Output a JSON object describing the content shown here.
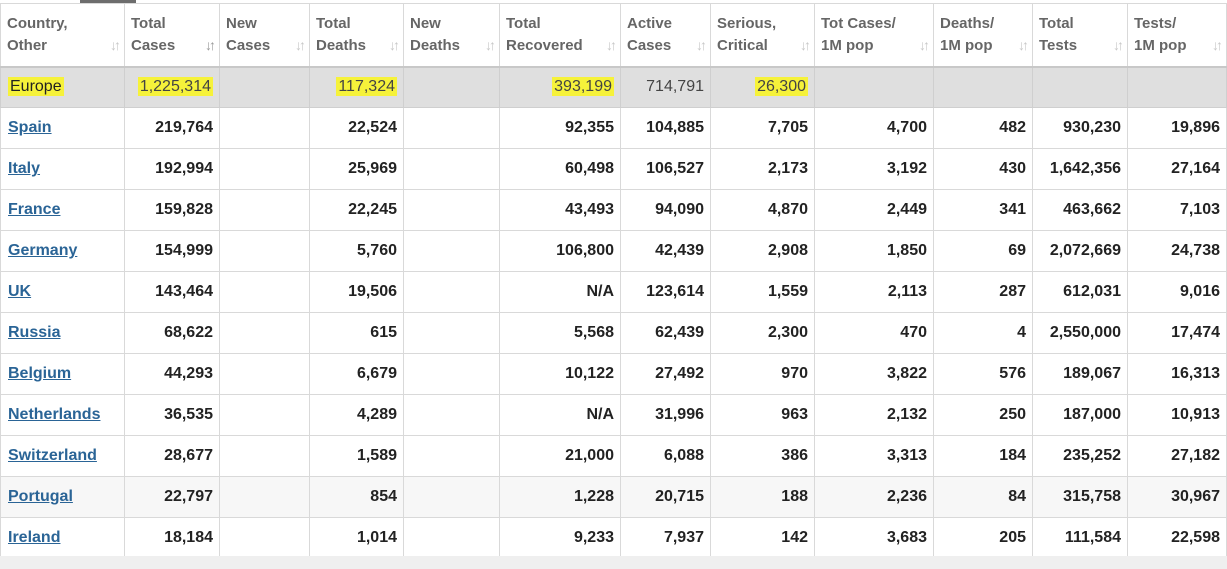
{
  "columns": [
    {
      "label1": "Country,",
      "label2": "Other"
    },
    {
      "label1": "Total",
      "label2": "Cases"
    },
    {
      "label1": "New",
      "label2": "Cases"
    },
    {
      "label1": "Total",
      "label2": "Deaths"
    },
    {
      "label1": "New",
      "label2": "Deaths"
    },
    {
      "label1": "Total",
      "label2": "Recovered"
    },
    {
      "label1": "Active",
      "label2": "Cases"
    },
    {
      "label1": "Serious,",
      "label2": "Critical"
    },
    {
      "label1": "Tot Cases/",
      "label2": "1M pop"
    },
    {
      "label1": "Deaths/",
      "label2": "1M pop"
    },
    {
      "label1": "Total",
      "label2": "Tests"
    },
    {
      "label1": "Tests/",
      "label2": "1M pop"
    }
  ],
  "icons": {
    "sort": "sort-arrows-icon",
    "sort_glyph": "↓↑",
    "sort_active": "sort-descending-icon",
    "highlight_color": "#f6f23a",
    "link_color": "#2a6496"
  },
  "region": {
    "country": "Europe",
    "total_cases": "1,225,314",
    "new_cases": "",
    "total_deaths": "117,324",
    "new_deaths": "",
    "total_recovered": "393,199",
    "active_cases": "714,791",
    "serious_critical": "26,300",
    "tot_cases_1m": "",
    "deaths_1m": "",
    "total_tests": "",
    "tests_1m": ""
  },
  "rows": [
    {
      "country": "Spain",
      "total_cases": "219,764",
      "new_cases": "",
      "total_deaths": "22,524",
      "new_deaths": "",
      "total_recovered": "92,355",
      "active_cases": "104,885",
      "serious_critical": "7,705",
      "tot_cases_1m": "4,700",
      "deaths_1m": "482",
      "total_tests": "930,230",
      "tests_1m": "19,896"
    },
    {
      "country": "Italy",
      "total_cases": "192,994",
      "new_cases": "",
      "total_deaths": "25,969",
      "new_deaths": "",
      "total_recovered": "60,498",
      "active_cases": "106,527",
      "serious_critical": "2,173",
      "tot_cases_1m": "3,192",
      "deaths_1m": "430",
      "total_tests": "1,642,356",
      "tests_1m": "27,164"
    },
    {
      "country": "France",
      "total_cases": "159,828",
      "new_cases": "",
      "total_deaths": "22,245",
      "new_deaths": "",
      "total_recovered": "43,493",
      "active_cases": "94,090",
      "serious_critical": "4,870",
      "tot_cases_1m": "2,449",
      "deaths_1m": "341",
      "total_tests": "463,662",
      "tests_1m": "7,103"
    },
    {
      "country": "Germany",
      "total_cases": "154,999",
      "new_cases": "",
      "total_deaths": "5,760",
      "new_deaths": "",
      "total_recovered": "106,800",
      "active_cases": "42,439",
      "serious_critical": "2,908",
      "tot_cases_1m": "1,850",
      "deaths_1m": "69",
      "total_tests": "2,072,669",
      "tests_1m": "24,738"
    },
    {
      "country": "UK",
      "total_cases": "143,464",
      "new_cases": "",
      "total_deaths": "19,506",
      "new_deaths": "",
      "total_recovered": "N/A",
      "active_cases": "123,614",
      "serious_critical": "1,559",
      "tot_cases_1m": "2,113",
      "deaths_1m": "287",
      "total_tests": "612,031",
      "tests_1m": "9,016"
    },
    {
      "country": "Russia",
      "total_cases": "68,622",
      "new_cases": "",
      "total_deaths": "615",
      "new_deaths": "",
      "total_recovered": "5,568",
      "active_cases": "62,439",
      "serious_critical": "2,300",
      "tot_cases_1m": "470",
      "deaths_1m": "4",
      "total_tests": "2,550,000",
      "tests_1m": "17,474"
    },
    {
      "country": "Belgium",
      "total_cases": "44,293",
      "new_cases": "",
      "total_deaths": "6,679",
      "new_deaths": "",
      "total_recovered": "10,122",
      "active_cases": "27,492",
      "serious_critical": "970",
      "tot_cases_1m": "3,822",
      "deaths_1m": "576",
      "total_tests": "189,067",
      "tests_1m": "16,313"
    },
    {
      "country": "Netherlands",
      "total_cases": "36,535",
      "new_cases": "",
      "total_deaths": "4,289",
      "new_deaths": "",
      "total_recovered": "N/A",
      "active_cases": "31,996",
      "serious_critical": "963",
      "tot_cases_1m": "2,132",
      "deaths_1m": "250",
      "total_tests": "187,000",
      "tests_1m": "10,913"
    },
    {
      "country": "Switzerland",
      "total_cases": "28,677",
      "new_cases": "",
      "total_deaths": "1,589",
      "new_deaths": "",
      "total_recovered": "21,000",
      "active_cases": "6,088",
      "serious_critical": "386",
      "tot_cases_1m": "3,313",
      "deaths_1m": "184",
      "total_tests": "235,252",
      "tests_1m": "27,182"
    },
    {
      "country": "Portugal",
      "total_cases": "22,797",
      "new_cases": "",
      "total_deaths": "854",
      "new_deaths": "",
      "total_recovered": "1,228",
      "active_cases": "20,715",
      "serious_critical": "188",
      "tot_cases_1m": "2,236",
      "deaths_1m": "84",
      "total_tests": "315,758",
      "tests_1m": "30,967"
    },
    {
      "country": "Ireland",
      "total_cases": "18,184",
      "new_cases": "",
      "total_deaths": "1,014",
      "new_deaths": "",
      "total_recovered": "9,233",
      "active_cases": "7,937",
      "serious_critical": "142",
      "tot_cases_1m": "3,683",
      "deaths_1m": "205",
      "total_tests": "111,584",
      "tests_1m": "22,598"
    }
  ]
}
